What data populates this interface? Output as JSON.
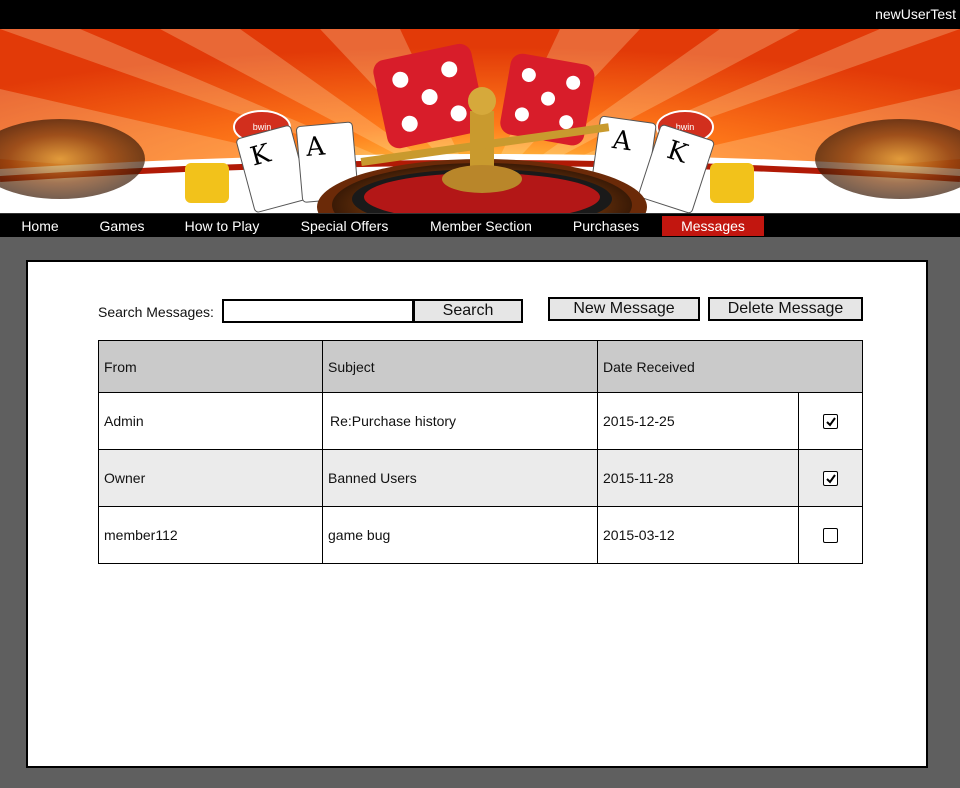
{
  "header": {
    "username": "newUserTest"
  },
  "nav": {
    "items": [
      {
        "label": "Home"
      },
      {
        "label": "Games"
      },
      {
        "label": "How to Play"
      },
      {
        "label": "Special Offers"
      },
      {
        "label": "Member Section"
      },
      {
        "label": "Purchases"
      },
      {
        "label": "Messages"
      }
    ],
    "active": "Messages",
    "active_color": "#c2160f"
  },
  "search": {
    "label": "Search Messages:",
    "value": "",
    "button": "Search"
  },
  "actions": {
    "new_message": "New Message",
    "delete_message": "Delete Message"
  },
  "table": {
    "headers": [
      "From",
      "Subject",
      "Date Received",
      ""
    ],
    "rows": [
      {
        "from": "Admin",
        "subject": "Re:Purchase history",
        "date": "2015-12-25",
        "checked": true
      },
      {
        "from": "Owner",
        "subject": "Banned Users",
        "date": "2015-11-28",
        "checked": true
      },
      {
        "from": "member112",
        "subject": "game bug",
        "date": "2015-03-12",
        "checked": false
      }
    ]
  },
  "banner": {
    "card_text": [
      "K",
      "A",
      "A",
      "K"
    ],
    "chip_text": [
      "bwin",
      "bwin"
    ]
  }
}
